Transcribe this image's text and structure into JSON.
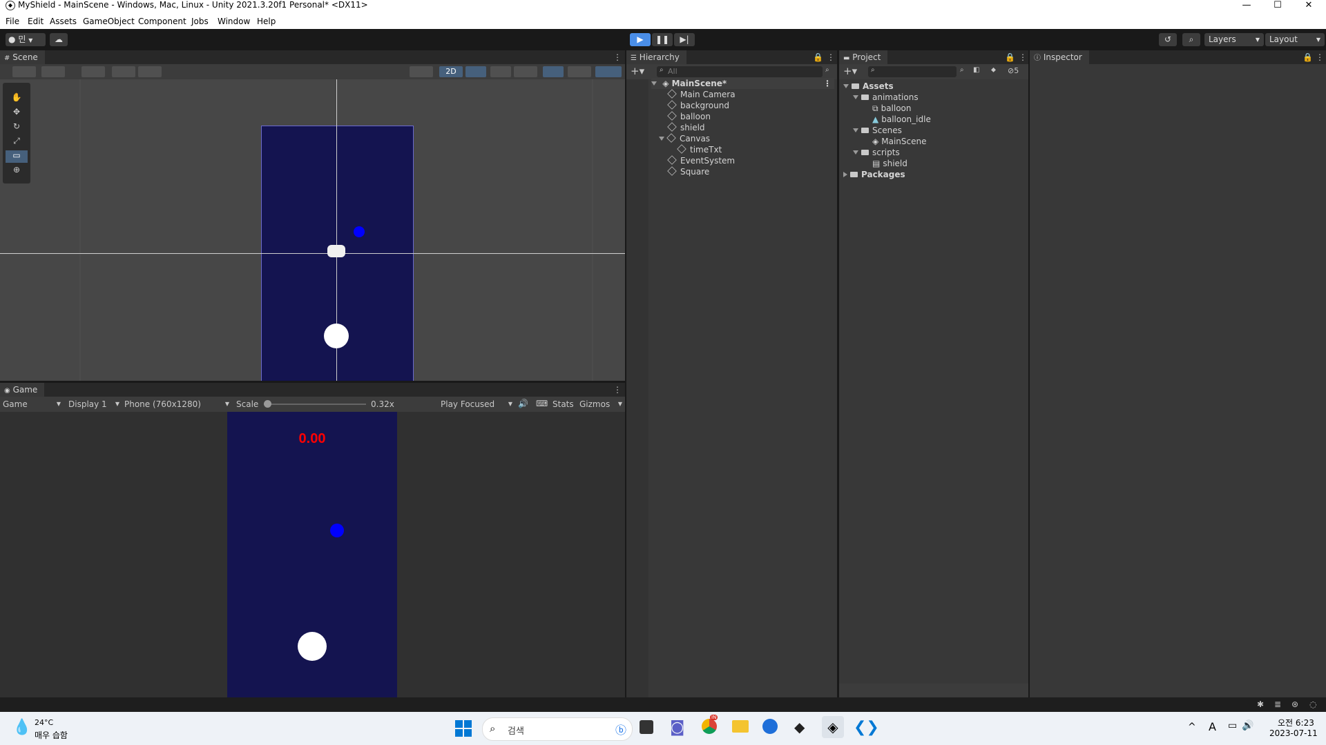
{
  "window": {
    "title": "MyShield - MainScene - Windows, Mac, Linux - Unity 2021.3.20f1 Personal* <DX11>",
    "minimize": "—",
    "maximize": "☐",
    "close": "✕"
  },
  "menu": [
    "File",
    "Edit",
    "Assets",
    "GameObject",
    "Component",
    "Jobs",
    "Window",
    "Help"
  ],
  "toolbar": {
    "account_label": "민",
    "layers_label": "Layers",
    "layout_label": "Layout"
  },
  "scene": {
    "tab_label": "Scene",
    "mode_2d_label": "2D"
  },
  "game": {
    "tab_label": "Game",
    "game_dropdown": "Game",
    "display_dropdown": "Display 1",
    "resolution_dropdown": "Phone (760x1280)",
    "scale_label": "Scale",
    "scale_value": "0.32x",
    "scale_fraction": 0.0,
    "play_focused": "Play Focused",
    "stats_label": "Stats",
    "gizmos_label": "Gizmos",
    "timer_text": "0.00"
  },
  "hierarchy": {
    "tab_label": "Hierarchy",
    "search_placeholder": "All",
    "scene_name": "MainScene*",
    "items": [
      "Main Camera",
      "background",
      "balloon",
      "shield",
      "Canvas",
      "timeTxt",
      "EventSystem",
      "Square"
    ]
  },
  "project": {
    "tab_label": "Project",
    "hidden_count": "5",
    "tree": {
      "assets": "Assets",
      "animations": "animations",
      "anim_balloon": "balloon",
      "anim_balloon_idle": "balloon_idle",
      "scenes": "Scenes",
      "main_scene": "MainScene",
      "scripts": "scripts",
      "script_shield": "shield",
      "packages": "Packages"
    }
  },
  "inspector": {
    "tab_label": "Inspector"
  },
  "taskbar": {
    "temperature": "24°C",
    "weather": "매우 습함",
    "search_placeholder": "검색",
    "time": "오전 6:23",
    "date": "2023-07-11",
    "chrome_badge": "IN"
  },
  "colors": {
    "game_bg": "#141450",
    "shield_ball": "#0000ff",
    "timer": "#ff0000",
    "play_accent": "#4a8ee8"
  }
}
